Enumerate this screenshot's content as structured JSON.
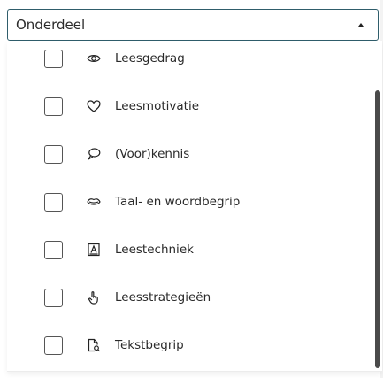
{
  "select": {
    "label": "Onderdeel",
    "caret_icon": "caret-up-icon"
  },
  "options": [
    {
      "label": "Leesgedrag",
      "icon": "eye-icon",
      "checked": false
    },
    {
      "label": "Leesmotivatie",
      "icon": "heart-icon",
      "checked": false
    },
    {
      "label": "(Voor)kennis",
      "icon": "speech-bubble-icon",
      "checked": false
    },
    {
      "label": "Taal- en woordbegrip",
      "icon": "lips-icon",
      "checked": false
    },
    {
      "label": "Leestechniek",
      "icon": "letter-card-icon",
      "checked": false
    },
    {
      "label": "Leesstrategieën",
      "icon": "pointing-hand-icon",
      "checked": false
    },
    {
      "label": "Tekstbegrip",
      "icon": "document-search-icon",
      "checked": false
    }
  ],
  "colors": {
    "border_accent": "#2f5d6b",
    "scrollbar": "#4a4a4a",
    "text": "#2a2a2a"
  }
}
